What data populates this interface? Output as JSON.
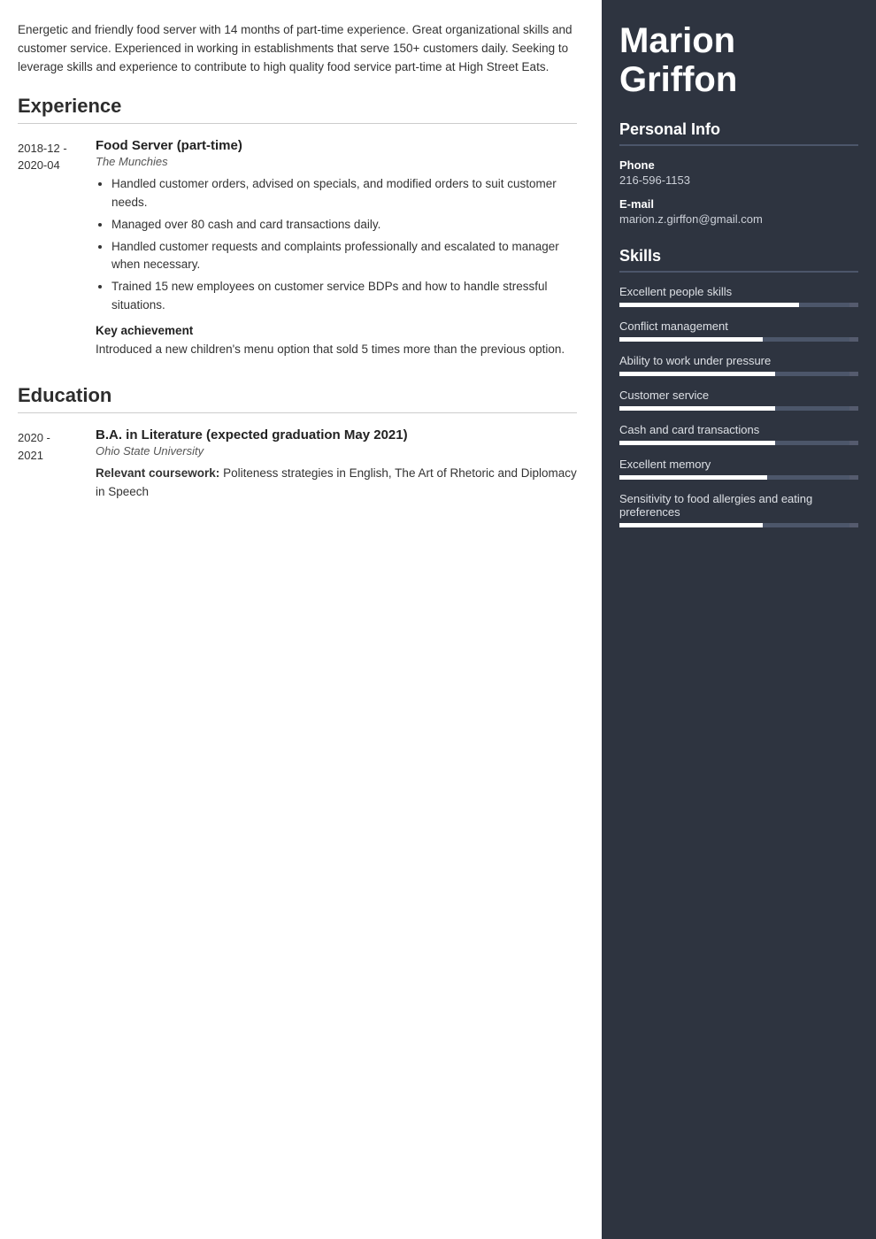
{
  "left": {
    "summary": "Energetic and friendly food server with 14 months of part-time experience. Great organizational skills and customer service. Experienced in working in establishments that serve 150+ customers daily. Seeking to leverage skills and experience to contribute to high quality food service part-time at High Street Eats.",
    "experience_title": "Experience",
    "experience_entries": [
      {
        "date": "2018-12 -\n2020-04",
        "title": "Food Server (part-time)",
        "org": "The Munchies",
        "bullets": [
          "Handled customer orders, advised on specials, and modified orders to suit customer needs.",
          "Managed over 80 cash and card transactions daily.",
          "Handled customer requests and complaints professionally and escalated to manager when necessary.",
          "Trained 15 new employees on customer service BDPs and how to handle stressful situations."
        ],
        "key_achievement_label": "Key achievement",
        "key_achievement_text": "Introduced a new children's menu option that sold 5 times more than the previous option."
      }
    ],
    "education_title": "Education",
    "education_entries": [
      {
        "date": "2020 -\n2021",
        "title": "B.A. in Literature (expected graduation May 2021)",
        "org": "Ohio State University",
        "coursework_label": "Relevant coursework:",
        "coursework_text": "Politeness strategies in English, The Art of Rhetoric and Diplomacy in Speech"
      }
    ]
  },
  "right": {
    "name_first": "Marion",
    "name_last": "Griffon",
    "personal_info_title": "Personal Info",
    "phone_label": "Phone",
    "phone_value": "216-596-1153",
    "email_label": "E-mail",
    "email_value": "marion.z.girffon@gmail.com",
    "skills_title": "Skills",
    "skills": [
      {
        "name": "Excellent people skills",
        "fill_pct": 75
      },
      {
        "name": "Conflict management",
        "fill_pct": 60
      },
      {
        "name": "Ability to work under pressure",
        "fill_pct": 65
      },
      {
        "name": "Customer service",
        "fill_pct": 65
      },
      {
        "name": "Cash and card transactions",
        "fill_pct": 65
      },
      {
        "name": "Excellent memory",
        "fill_pct": 62
      },
      {
        "name": "Sensitivity to food allergies and eating preferences",
        "fill_pct": 60
      }
    ]
  }
}
